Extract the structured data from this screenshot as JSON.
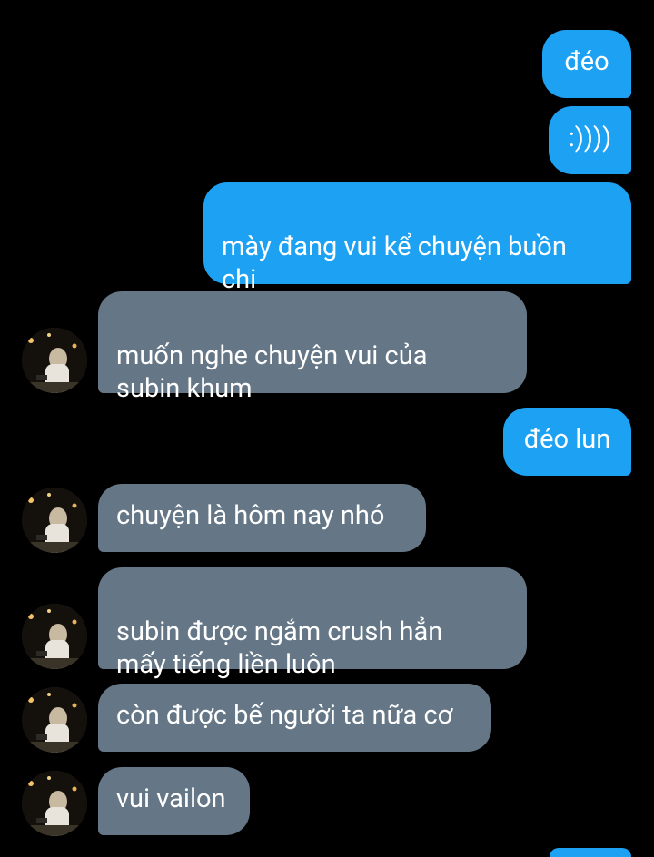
{
  "messages": [
    {
      "id": "m1",
      "dir": "out",
      "text": "đéo"
    },
    {
      "id": "m2",
      "dir": "out",
      "text": ":))))"
    },
    {
      "id": "m3",
      "dir": "out",
      "text": "mày đang vui kể chuyện buồn\nchi"
    },
    {
      "id": "m4",
      "dir": "in",
      "text": "muốn nghe chuyện vui của\nsubin khum"
    },
    {
      "id": "m5",
      "dir": "out",
      "text": "đéo lun"
    },
    {
      "id": "m6",
      "dir": "in",
      "text": "chuyện là hôm nay nhó"
    },
    {
      "id": "m7",
      "dir": "in",
      "text": "subin được ngắm crush hẳn\nmấy tiếng liền luôn"
    },
    {
      "id": "m8",
      "dir": "in",
      "text": "còn được bế người ta nữa cơ"
    },
    {
      "id": "m9",
      "dir": "in",
      "text": "vui vailon"
    }
  ],
  "colors": {
    "background": "#000000",
    "outgoing_bubble": "#1da1f2",
    "incoming_bubble": "#657786",
    "text": "#ffffff"
  },
  "icons": {
    "avatar": "contact-avatar-photo"
  }
}
